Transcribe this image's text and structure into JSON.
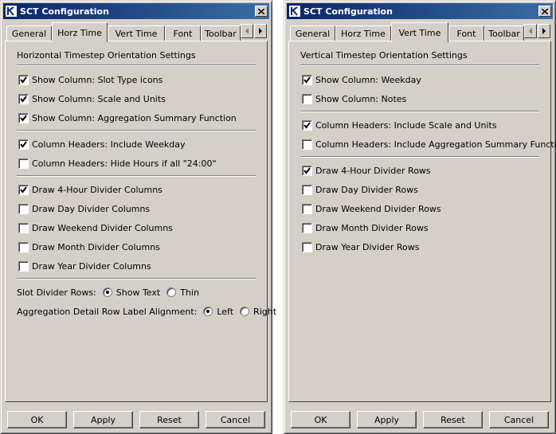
{
  "windows": [
    {
      "title": "SCT Configuration",
      "tabs": [
        {
          "label": "General",
          "active": false
        },
        {
          "label": "Horz Time",
          "active": true
        },
        {
          "label": "Vert Time",
          "active": false
        },
        {
          "label": "Font",
          "active": false
        },
        {
          "label": "Toolbar",
          "active": false
        }
      ],
      "panel_title": "Horizontal Timestep Orientation Settings",
      "groups": [
        [
          {
            "label": "Show Column: Slot Type icons",
            "checked": true
          },
          {
            "label": "Show Column: Scale and Units",
            "checked": true
          },
          {
            "label": "Show Column: Aggregation Summary Function",
            "checked": true
          }
        ],
        [
          {
            "label": "Column Headers: Include Weekday",
            "checked": true
          },
          {
            "label": "Column Headers: Hide Hours if all \"24:00\"",
            "checked": false
          }
        ],
        [
          {
            "label": "Draw 4-Hour Divider Columns",
            "checked": true
          },
          {
            "label": "Draw Day Divider Columns",
            "checked": false
          },
          {
            "label": "Draw Weekend Divider Columns",
            "checked": false
          },
          {
            "label": "Draw Month Divider Columns",
            "checked": false
          },
          {
            "label": "Draw Year Divider Columns",
            "checked": false
          }
        ]
      ],
      "slot_divider_rows": {
        "label": "Slot Divider Rows:",
        "options": [
          {
            "label": "Show Text",
            "selected": true
          },
          {
            "label": "Thin",
            "selected": false
          }
        ]
      },
      "aggregation_alignment": {
        "label": "Aggregation Detail Row Label Alignment:",
        "options": [
          {
            "label": "Left",
            "selected": true
          },
          {
            "label": "Right",
            "selected": false
          }
        ]
      },
      "buttons": {
        "ok": "OK",
        "apply": "Apply",
        "reset": "Reset",
        "cancel": "Cancel"
      }
    },
    {
      "title": "SCT Configuration",
      "tabs": [
        {
          "label": "General",
          "active": false
        },
        {
          "label": "Horz Time",
          "active": false
        },
        {
          "label": "Vert Time",
          "active": true
        },
        {
          "label": "Font",
          "active": false
        },
        {
          "label": "Toolbar",
          "active": false
        }
      ],
      "panel_title": "Vertical Timestep Orientation Settings",
      "groups": [
        [
          {
            "label": "Show Column: Weekday",
            "checked": true
          },
          {
            "label": "Show Column: Notes",
            "checked": false
          }
        ],
        [
          {
            "label": "Column Headers: Include Scale and Units",
            "checked": true
          },
          {
            "label": "Column Headers: Include Aggregation Summary Function",
            "checked": false
          }
        ],
        [
          {
            "label": "Draw 4-Hour Divider Rows",
            "checked": true
          },
          {
            "label": "Draw Day Divider Rows",
            "checked": false
          },
          {
            "label": "Draw Weekend Divider Rows",
            "checked": false
          },
          {
            "label": "Draw Month Divider Rows",
            "checked": false
          },
          {
            "label": "Draw Year Divider Rows",
            "checked": false
          }
        ]
      ],
      "buttons": {
        "ok": "OK",
        "apply": "Apply",
        "reset": "Reset",
        "cancel": "Cancel"
      }
    }
  ]
}
